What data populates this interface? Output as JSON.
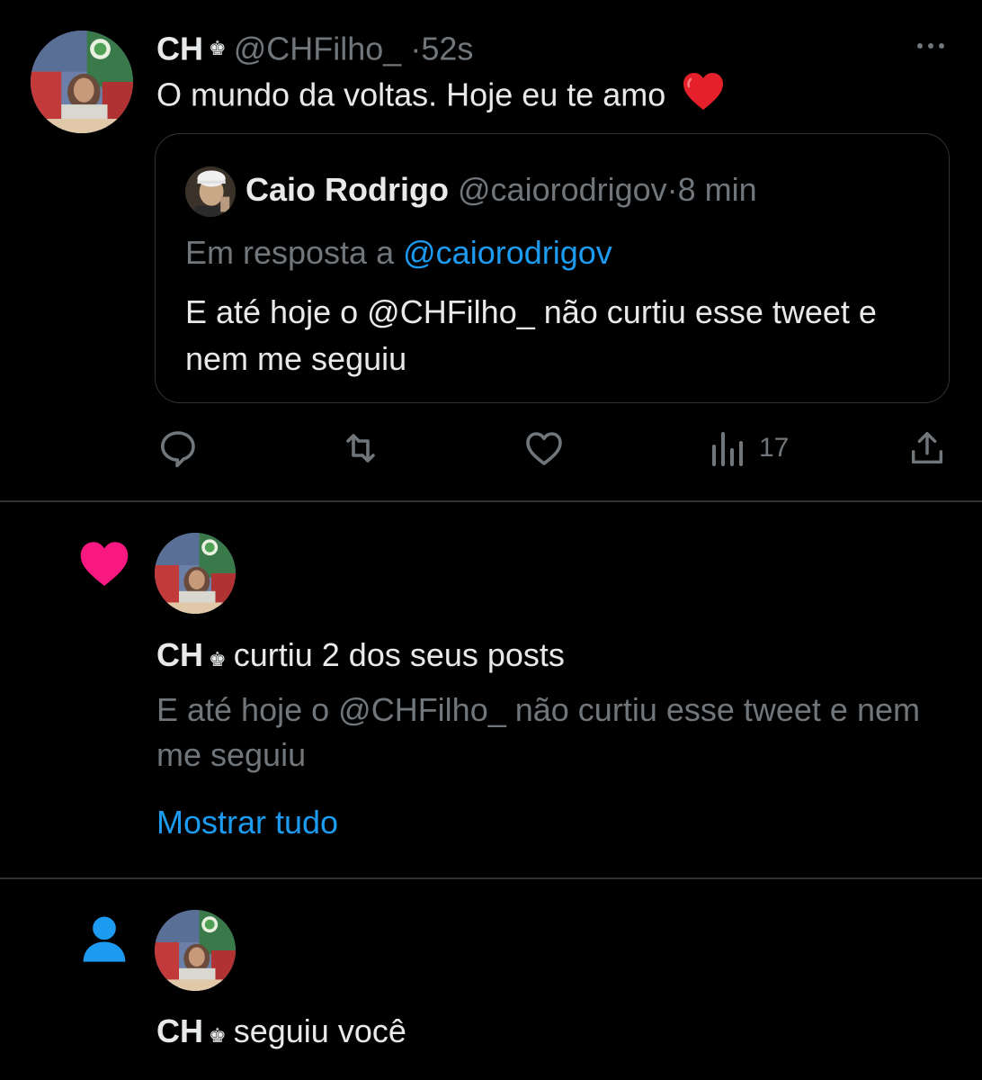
{
  "tweet": {
    "author_name": "CH",
    "verified_badge": "♚",
    "handle": "@CHFilho_",
    "separator": "·",
    "time": "52s",
    "text": "O mundo da voltas. Hoje eu te amo",
    "emoji": "heart-emoji",
    "quoted": {
      "author_name": "Caio Rodrigo",
      "handle": "@caiorodrigov",
      "separator": "·",
      "time": "8 min",
      "reply_prefix": "Em resposta a",
      "reply_handle": "@caiorodrigov",
      "text": "E até hoje o @CHFilho_ não curtiu esse tweet e nem me seguiu"
    },
    "actions": {
      "reply_icon": "comment-icon",
      "retweet_icon": "retweet-icon",
      "like_icon": "heart-outline-icon",
      "views_icon": "bar-chart-icon",
      "views_count": "17",
      "share_icon": "share-icon"
    }
  },
  "notifications": [
    {
      "type_icon": "heart-icon",
      "type_color": "#f91880",
      "user_name": "CH",
      "badge": "♚",
      "action_text": "curtiu 2 dos seus posts",
      "preview_text": "E até hoje o @CHFilho_ não curtiu esse tweet e nem me seguiu",
      "show_all_label": "Mostrar tudo"
    },
    {
      "type_icon": "person-icon",
      "type_color": "#1d9bf0",
      "user_name": "CH",
      "badge": "♚",
      "action_text": "seguiu você"
    }
  ],
  "colors": {
    "background": "#000000",
    "text_primary": "#e7e9ea",
    "text_muted": "#71767b",
    "link": "#1d9bf0",
    "border": "#2f3336"
  }
}
